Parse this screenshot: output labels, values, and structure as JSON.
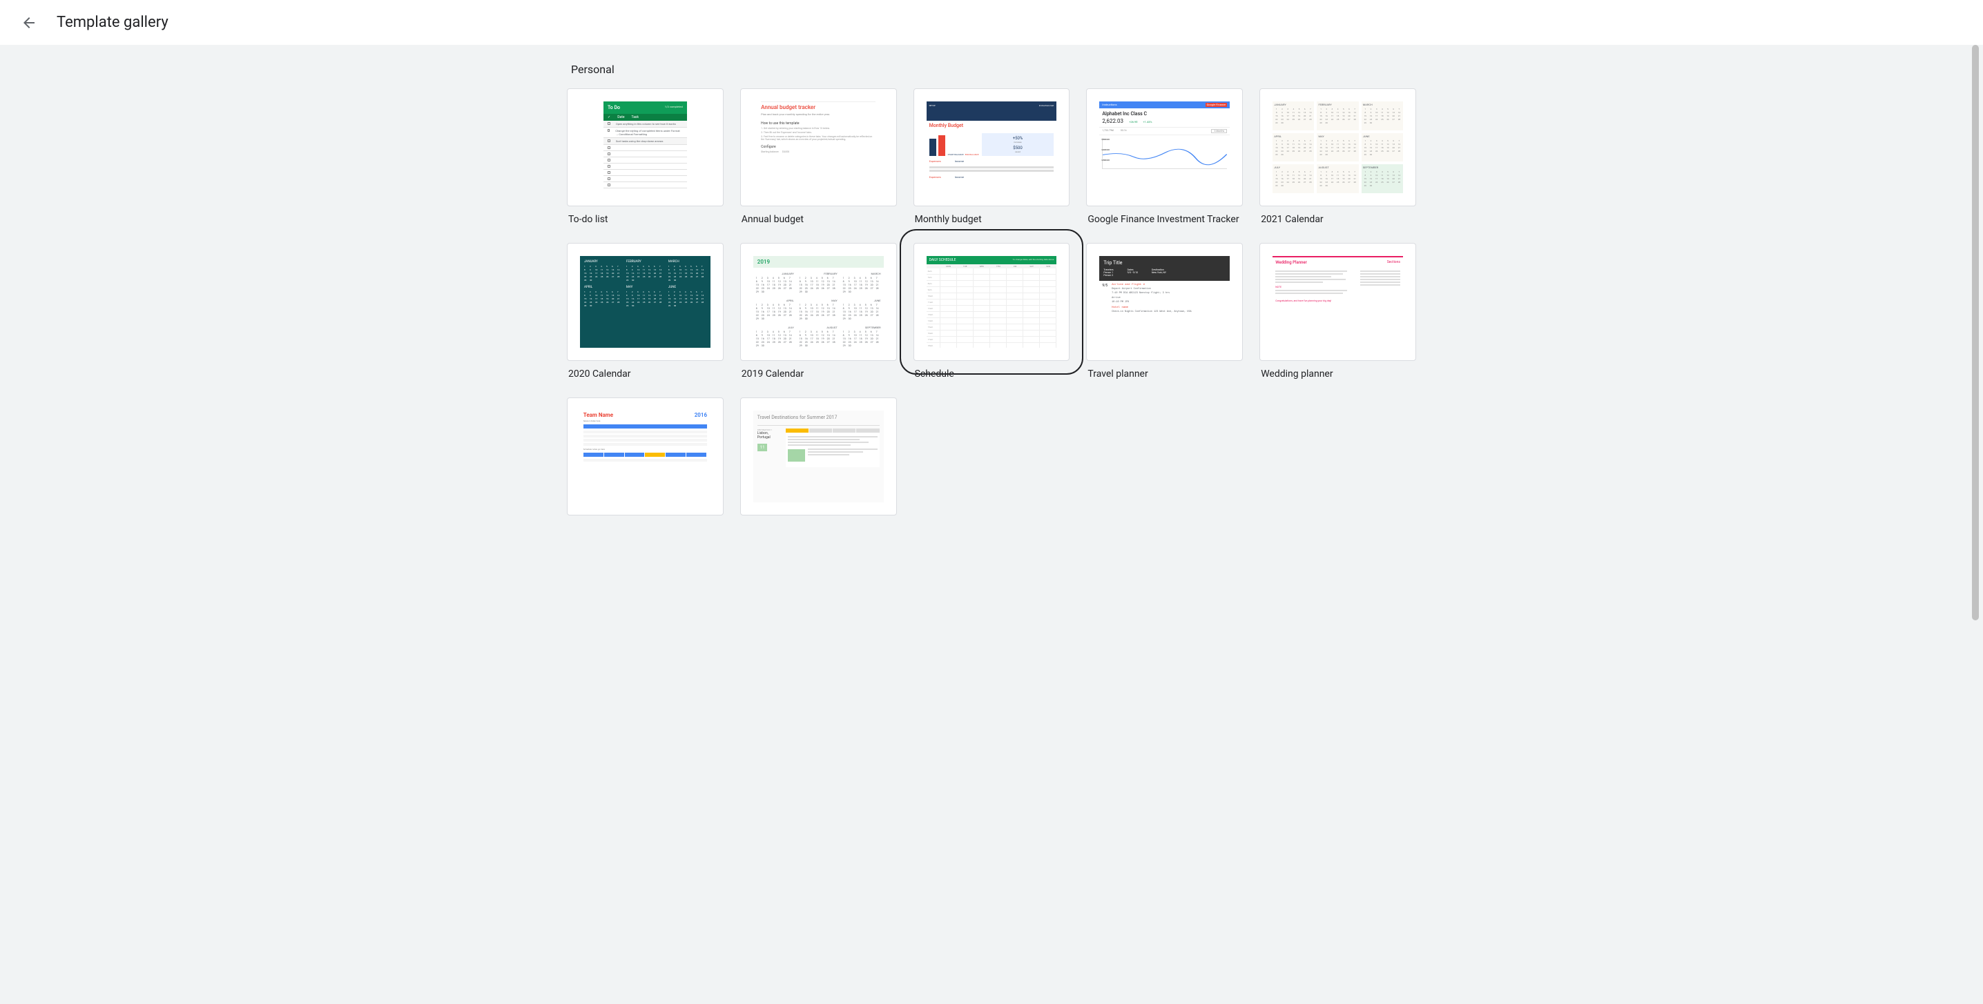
{
  "header": {
    "title": "Template gallery"
  },
  "section": {
    "title": "Personal"
  },
  "templates": [
    {
      "id": "todo",
      "label": "To-do list",
      "focused": false
    },
    {
      "id": "annual",
      "label": "Annual budget",
      "focused": false
    },
    {
      "id": "monthly",
      "label": "Monthly budget",
      "focused": false
    },
    {
      "id": "finance",
      "label": "Google Finance Investment Tracker",
      "focused": false
    },
    {
      "id": "cal2021",
      "label": "2021 Calendar",
      "focused": false
    },
    {
      "id": "cal2020",
      "label": "2020 Calendar",
      "focused": false
    },
    {
      "id": "cal2019",
      "label": "2019 Calendar",
      "focused": false
    },
    {
      "id": "schedule",
      "label": "Schedule",
      "focused": true
    },
    {
      "id": "travel",
      "label": "Travel planner",
      "focused": false
    },
    {
      "id": "wedding",
      "label": "Wedding planner",
      "focused": false
    },
    {
      "id": "team",
      "label": "",
      "focused": false
    },
    {
      "id": "dest",
      "label": "",
      "focused": false
    }
  ],
  "previews": {
    "todo": {
      "title": "To Do",
      "counter": "1/3 completed",
      "cols": [
        "✓",
        "Date",
        "Task"
      ]
    },
    "annual": {
      "title": "Annual budget tracker",
      "subtitle": "Plan and track your monthly spending for the entire year.",
      "howto": "How to use this template",
      "step1": "1. Get started by entering your starting balance in Row 13 below.",
      "step2": "2. Then fill out the 'Expenses' and 'Income' tabs.",
      "step3": "3. Feel free to rename or delete categories in these tabs. Your changes will automatically be reflected on the 'Summary' tab, which shows an overview of your projected/actual spending.",
      "config": "Configure",
      "balance_label": "Starting balance:",
      "balance_val": "$5,000"
    },
    "monthly": {
      "title": "Monthly Budget",
      "start": "START BALANCE",
      "end": "END BALANCE",
      "pct": "+50%",
      "amount": "$500",
      "exp": "Expenses",
      "inc": "Income"
    },
    "finance": {
      "name": "Alphabet Inc Class C",
      "price": "2,622.03",
      "change1": "+26.95",
      "change2": "+1.43%",
      "cap": "1,733.79M",
      "vol": "53.1k"
    },
    "cal2021": {
      "months": [
        "JANUARY",
        "FEBRUARY",
        "MARCH",
        "APRIL",
        "MAY",
        "JUNE",
        "JULY",
        "AUGUST",
        "SEPTEMBER"
      ]
    },
    "cal2020": {
      "months": [
        "JANUARY",
        "FEBRUARY",
        "MARCH",
        "APRIL",
        "MAY",
        "JUNE"
      ]
    },
    "cal2019": {
      "year": "2019",
      "months": [
        "JANUARY",
        "FEBRUARY",
        "MARCH",
        "APRIL",
        "MAY",
        "JUNE",
        "JULY",
        "AUGUST",
        "SEPTEMBER"
      ]
    },
    "schedule": {
      "title": "DAILY SCHEDULE",
      "days": [
        "",
        "MON",
        "TUE",
        "WED",
        "THU",
        "FRI",
        "SAT",
        "SUN"
      ]
    },
    "travel": {
      "title": "Trip Title",
      "travelers": "Travelers",
      "dates": "Dates",
      "persons": "Person 1\nPerson 2",
      "daterange": "9/5 - 9/10",
      "dest": "Destination\nNew York, NY",
      "day": "9/5",
      "flight": "Airline and flight #",
      "hotel": "Hotel name"
    },
    "wedding": {
      "title": "Wedding Planner",
      "sections": "Sections",
      "note": "NOTE",
      "congrats": "Congratulations, and have fun planning your big day!"
    },
    "team": {
      "name": "Team Name",
      "year": "2016"
    },
    "dest": {
      "title": "Travel Destinations for Summer 2017",
      "city": "Lisbon,\nPortugal",
      "num": "11"
    }
  }
}
